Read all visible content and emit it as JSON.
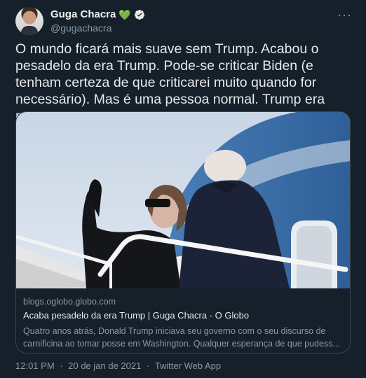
{
  "author": {
    "display_name": "Guga Chacra",
    "handle": "@gugachacra",
    "badge_emoji": "💚",
    "verified_icon": "verified-check-icon",
    "verified_color": "#e7e9ea"
  },
  "tweet": {
    "text": "O mundo ficará mais suave sem Trump. Acabou o pesadelo da era Trump. Pode-se criticar Biden (e tenham certeza de que criticarei muito quando for necessário). Mas é uma pessoa normal. Trump era mau"
  },
  "card": {
    "domain": "blogs.oglobo.globo.com",
    "title": "Acaba pesadelo da era Trump | Guga Chacra - O Globo",
    "description": "Quatro anos atrás, Donald Trump iniciava seu governo com o seu discurso de carnificina ao tomar posse em Washington. Qualquer esperança de que pudess..."
  },
  "footer": {
    "time": "12:01 PM",
    "separator": "·",
    "date": "20 de jan de 2021",
    "source": "Twitter Web App"
  },
  "colors": {
    "background": "#15202b",
    "border": "#38444d",
    "secondary_text": "#8b98a5",
    "primary_text": "#e7e9ea",
    "heart": "#5ec26a"
  }
}
